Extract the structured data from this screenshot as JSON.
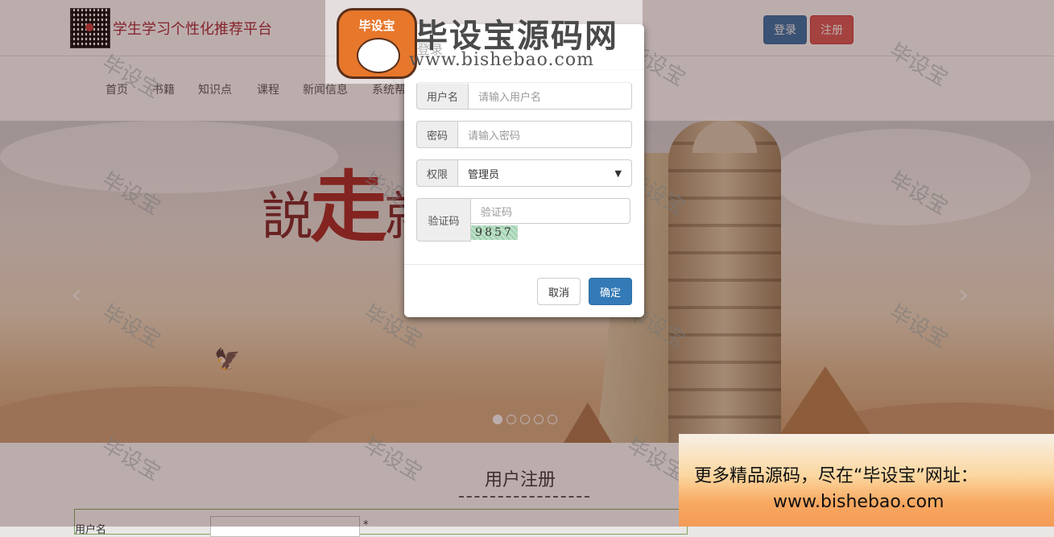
{
  "header": {
    "site_title": "学生学习个性化推荐平台",
    "login_label": "登录",
    "register_label": "注册"
  },
  "nav": {
    "items": [
      "首页",
      "书籍",
      "知识点",
      "课程",
      "新闻信息",
      "系统帮"
    ]
  },
  "banner": {
    "calligraphy": [
      "説",
      "走",
      "就"
    ],
    "prev_glyph": "‹",
    "next_glyph": "›",
    "slides_total": 5,
    "slide_active": 1
  },
  "register_section": {
    "title": "用户注册",
    "first_field_label": "用户名",
    "required_mark": "*"
  },
  "login_modal": {
    "title": "登录",
    "username_label": "用户名",
    "username_placeholder": "请输入用户名",
    "password_label": "密码",
    "password_placeholder": "请输入密码",
    "role_label": "权限",
    "role_selected": "管理员",
    "captcha_label": "验证码",
    "captcha_placeholder": "验证码",
    "captcha_code": "9857",
    "cancel_label": "取消",
    "confirm_label": "确定"
  },
  "watermark": {
    "logo_badge": "毕设宝",
    "logo_text": "毕设宝源码网",
    "logo_url": "www.bishebao.com",
    "tile_text": "毕设宝"
  },
  "promo": {
    "line1": "更多精品源码，尽在“毕设宝”网址：",
    "line2": "www.bishebao.com"
  },
  "colors": {
    "title_red": "#a5222f",
    "primary": "#337ab7",
    "danger": "#d9534f"
  }
}
